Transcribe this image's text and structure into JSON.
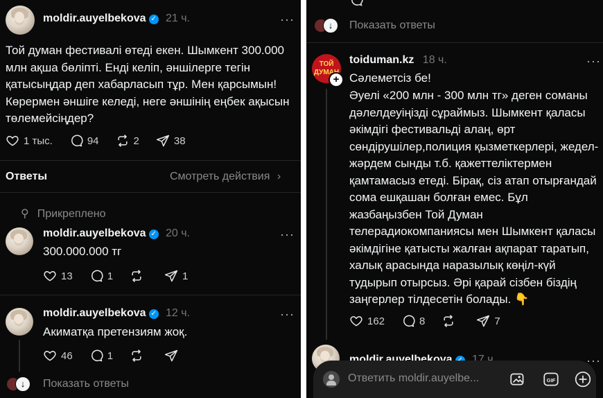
{
  "left": {
    "post": {
      "username": "moldir.auyelbekova",
      "time": "21 ч.",
      "text": "Той думан фестивалі өтеді екен. Шымкент 300.000 млн ақша бөліпті. Енді келіп, әншілерге тегін қатысыңдар деп хабарласып тұр. Мен қарсымын! Көрермен әншіге келеді, неге әншінің еңбек ақысын төлемейсіңдер?",
      "likes": "1 тыс.",
      "comments": "94",
      "reposts": "2",
      "shares": "38"
    },
    "replies_header": {
      "title": "Ответы",
      "view_activity": "Смотреть действия"
    },
    "pinned_label": "Прикреплено",
    "reply1": {
      "username": "moldir.auyelbekova",
      "time": "20 ч.",
      "text": "300.000.000 тг",
      "likes": "13",
      "comments": "1",
      "shares": "1"
    },
    "reply2": {
      "username": "moldir.auyelbekova",
      "time": "12 ч.",
      "text": "Акиматқа претензиям жоқ.",
      "likes": "46",
      "comments": "1"
    },
    "show_replies": "Показать ответы"
  },
  "right": {
    "show_replies": "Показать ответы",
    "post": {
      "username": "toiduman.kz",
      "time": "18 ч.",
      "avatar_text": "ТОЙ ДУМАН",
      "text_greeting": "Сәлеметсіз бе!",
      "text_body": "Әуелі «200 млн - 300 млн тг» деген соманы дәлелдеуіңізді сұраймыз. Шымкент қаласы әкімдігі фестивальді алаң, өрт сөндірушілер,полиция қызметкерлері, жедел-жәрдем сынды  т.б. қажеттеліктермен қамтамасыз етеді. Бірақ, сіз атап отырғандай сома ешқашан болған емес. Бұл жазбаңызбен Той Думан телерадиокомпаниясы мен Шымкент қаласы әкімдігіне қатысты жалған ақпарат таратып, халық арасында наразылық көңіл-күй тудырып отырсыз. Әрі қарай сізбен біздің заңгерлер тілдесетін болады. 👇",
      "likes": "162",
      "comments": "8",
      "shares": "7"
    },
    "next": {
      "username": "moldir.auyelbekova",
      "time": "17 ч."
    },
    "reply_placeholder": "Ответить moldir.auyelbe..."
  },
  "colors": {
    "background": "#0a0a0a",
    "text": "#f3f5f7",
    "muted": "#777777",
    "verified": "#0095f6",
    "brand": "#c0141c"
  }
}
